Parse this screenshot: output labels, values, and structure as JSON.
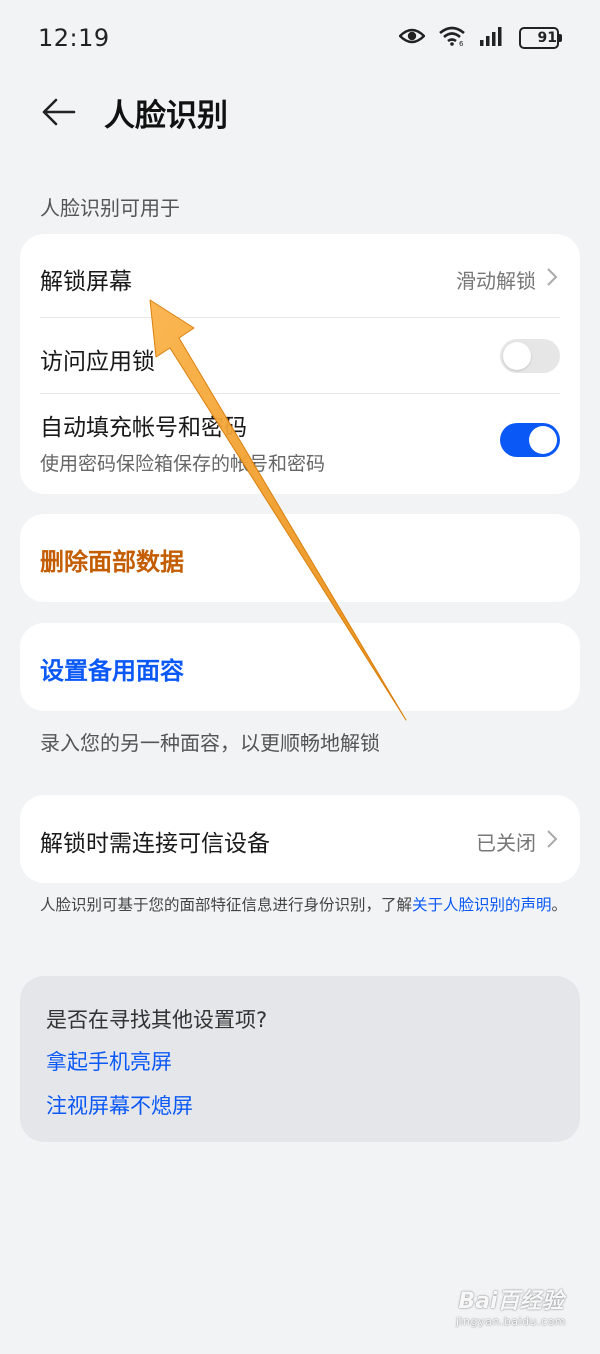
{
  "status_bar": {
    "time": "12:19",
    "battery": "91",
    "battery_level": 0.91,
    "icons": [
      "eye-icon",
      "wifi-icon",
      "signal-icon",
      "battery-icon"
    ]
  },
  "header": {
    "title": "人脸识别"
  },
  "section_label": "人脸识别可用于",
  "usage_card": {
    "unlock_screen": {
      "label": "解锁屏幕",
      "value": "滑动解锁"
    },
    "app_lock": {
      "label": "访问应用锁",
      "enabled": false
    },
    "autofill": {
      "label": "自动填充帐号和密码",
      "sublabel": "使用密码保险箱保存的帐号和密码",
      "enabled": true
    }
  },
  "delete_face": {
    "label": "删除面部数据",
    "color": "#c45c00"
  },
  "alt_face": {
    "label": "设置备用面容",
    "note": "录入您的另一种面容，以更顺畅地解锁",
    "color": "#0a59f7"
  },
  "trusted_device": {
    "label": "解锁时需连接可信设备",
    "value": "已关闭"
  },
  "disclaimer": {
    "text": "人脸识别可基于您的面部特征信息进行身份识别，了解",
    "link": "关于人脸识别的声明",
    "end": "。"
  },
  "suggestions": {
    "title": "是否在寻找其他设置项?",
    "links": [
      "拿起手机亮屏",
      "注视屏幕不熄屏"
    ]
  },
  "watermark": {
    "main": "Bai百经验",
    "sub": "jingyan.baidu.com"
  },
  "colors": {
    "accent": "#0a59f7",
    "warning": "#c45c00",
    "annotation_arrow": "#f5a623"
  }
}
